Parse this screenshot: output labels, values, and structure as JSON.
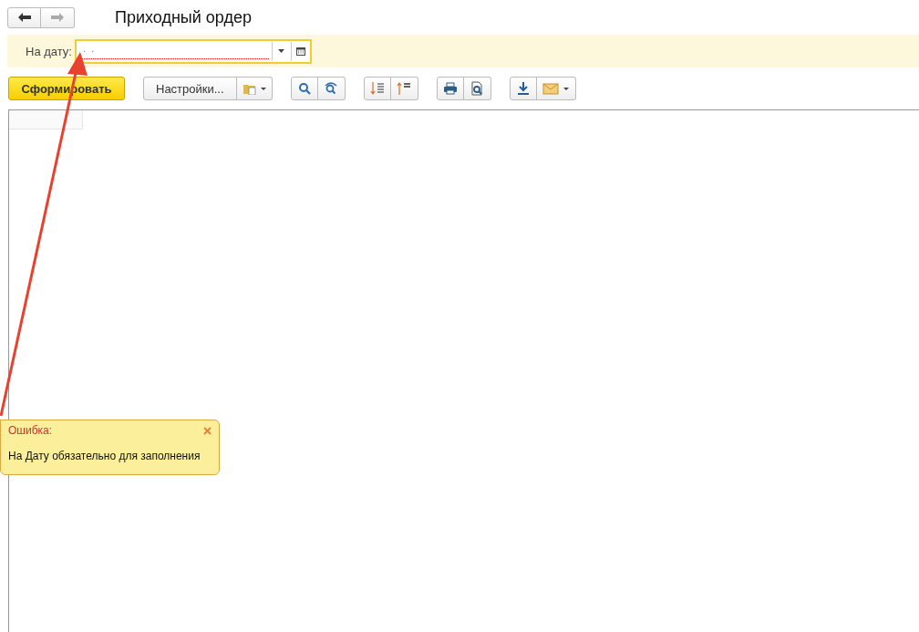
{
  "window": {
    "title": "Приходный ордер"
  },
  "nav": [
    {
      "kind": "back",
      "disabled": false
    },
    {
      "kind": "forward",
      "disabled": true
    }
  ],
  "filter": {
    "label": "На дату:",
    "value": " .  .",
    "invalid": true
  },
  "toolbar": {
    "generate": "Сформировать",
    "settings": "Настройки..."
  },
  "error": {
    "title": "Ошибка:",
    "message": "На Дату обязательно для заполнения"
  }
}
